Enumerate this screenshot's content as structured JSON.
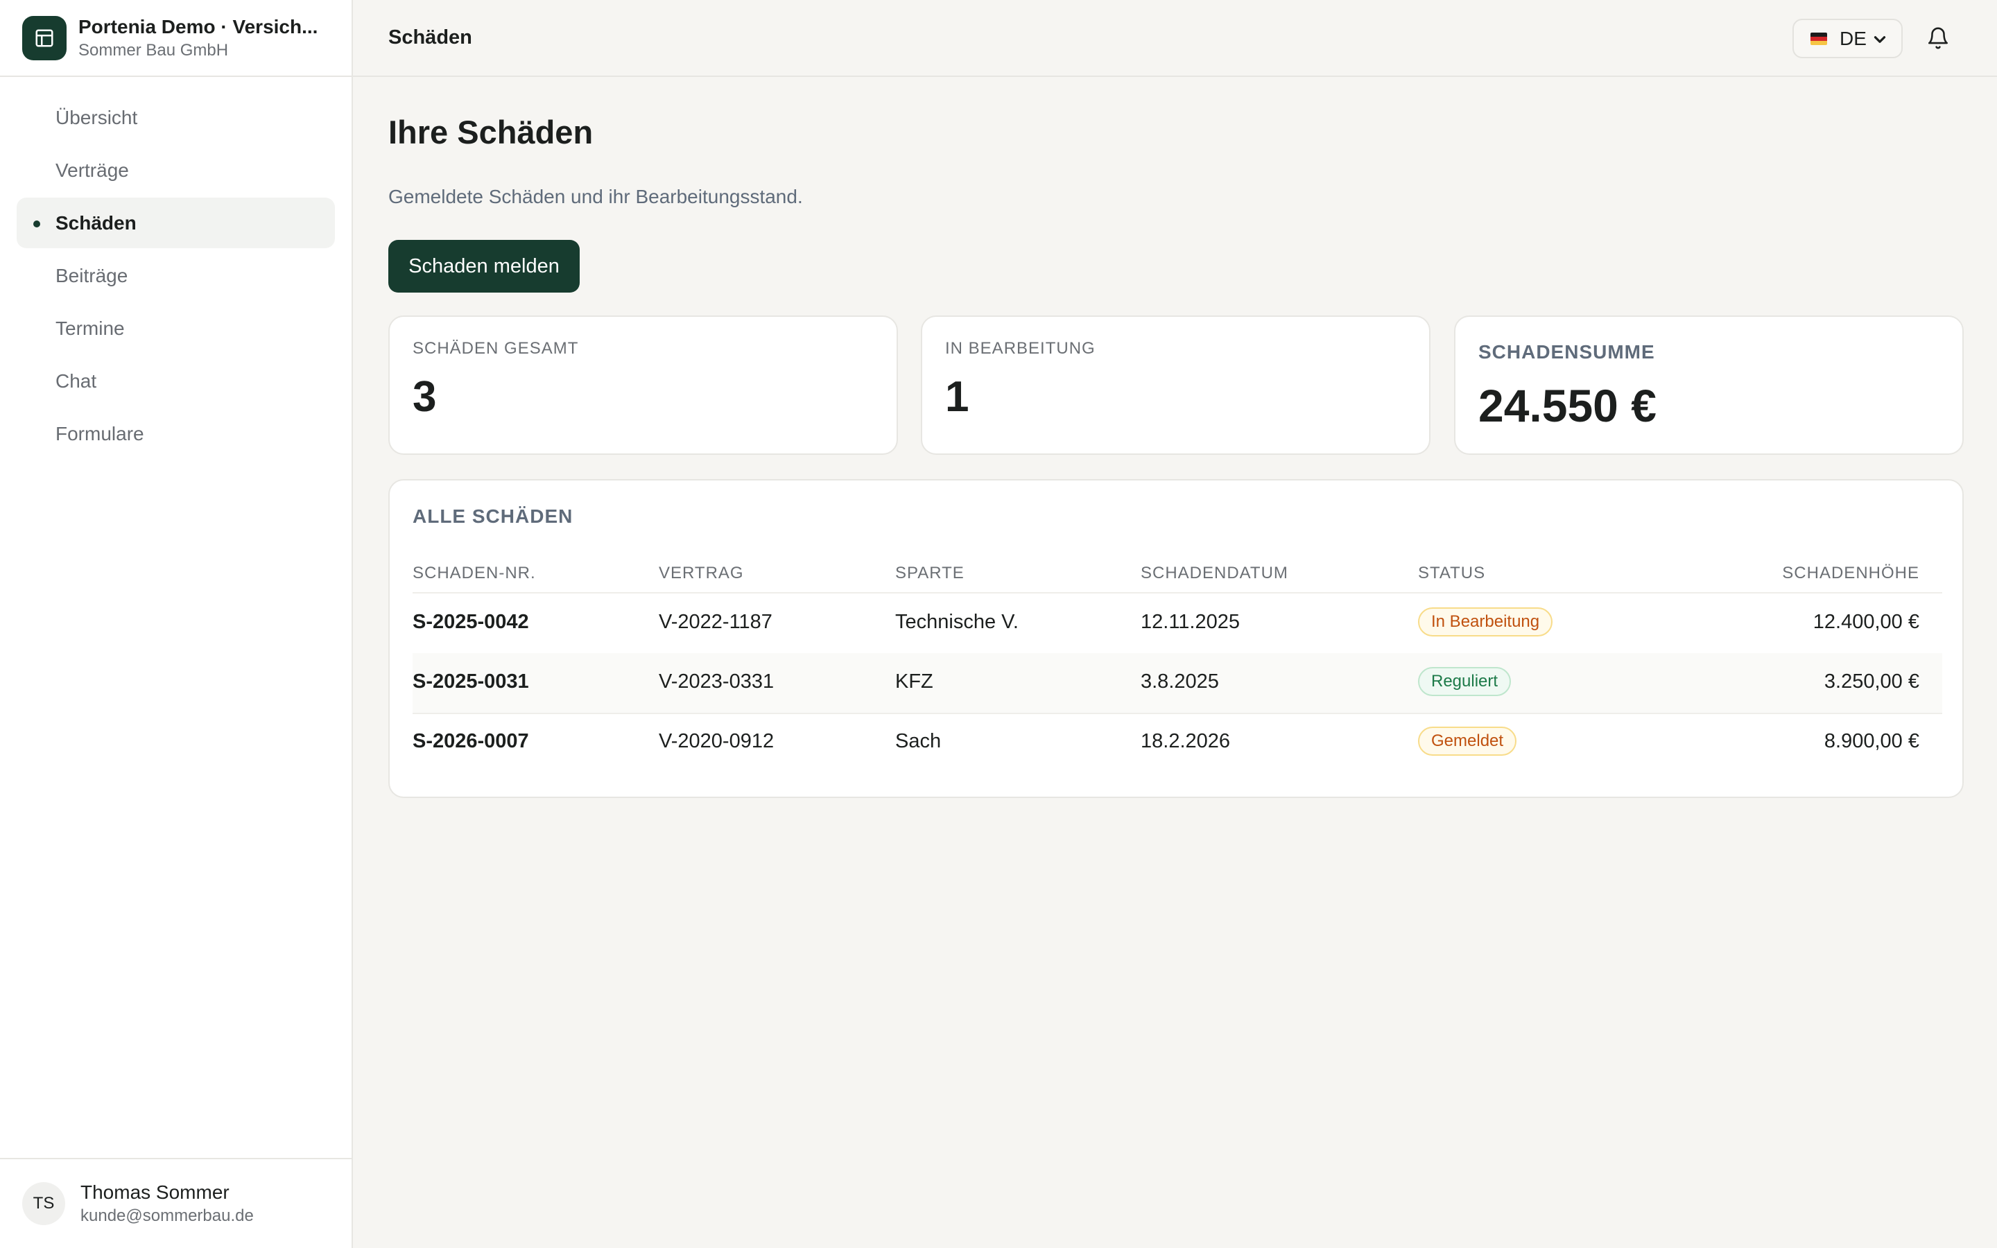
{
  "app": {
    "title": "Portenia Demo · Versich...",
    "company": "Sommer Bau GmbH"
  },
  "sidebar": {
    "items": [
      {
        "label": "Übersicht",
        "active": false
      },
      {
        "label": "Verträge",
        "active": false
      },
      {
        "label": "Schäden",
        "active": true
      },
      {
        "label": "Beiträge",
        "active": false
      },
      {
        "label": "Termine",
        "active": false
      },
      {
        "label": "Chat",
        "active": false
      },
      {
        "label": "Formulare",
        "active": false
      }
    ]
  },
  "user": {
    "initials": "TS",
    "name": "Thomas Sommer",
    "email": "kunde@sommerbau.de"
  },
  "topbar": {
    "title": "Schäden",
    "language": "DE"
  },
  "page": {
    "title": "Ihre Schäden",
    "subtitle": "Gemeldete Schäden und ihr Bearbeitungsstand.",
    "report_button": "Schaden melden"
  },
  "stats": [
    {
      "label": "SCHÄDEN GESAMT",
      "value": "3"
    },
    {
      "label": "IN BEARBEITUNG",
      "value": "1"
    },
    {
      "label": "SCHADENSUMME",
      "value": "24.550 €"
    }
  ],
  "table": {
    "title": "ALLE SCHÄDEN",
    "columns": [
      "SCHADEN-NR.",
      "VERTRAG",
      "SPARTE",
      "SCHADENDATUM",
      "STATUS",
      "SCHADENHÖHE"
    ],
    "rows": [
      {
        "id": "S-2025-0042",
        "contract": "V-2022-1187",
        "line": "Technische V.",
        "date": "12.11.2025",
        "status": "In Bearbeitung",
        "amount": "12.400,00 €"
      },
      {
        "id": "S-2025-0031",
        "contract": "V-2023-0331",
        "line": "KFZ",
        "date": "3.8.2025",
        "status": "Reguliert",
        "amount": "3.250,00 €"
      },
      {
        "id": "S-2026-0007",
        "contract": "V-2020-0912",
        "line": "Sach",
        "date": "18.2.2026",
        "status": "Gemeldet",
        "amount": "8.900,00 €"
      }
    ]
  },
  "colors": {
    "brand": "#173c2f",
    "status_orange": "#c0510f",
    "status_green": "#1c7a48"
  },
  "icons": {
    "logo": "layout-icon",
    "notifications": "bell-icon",
    "language_dropdown": "chevron-down-icon",
    "flag": "german-flag-icon"
  }
}
